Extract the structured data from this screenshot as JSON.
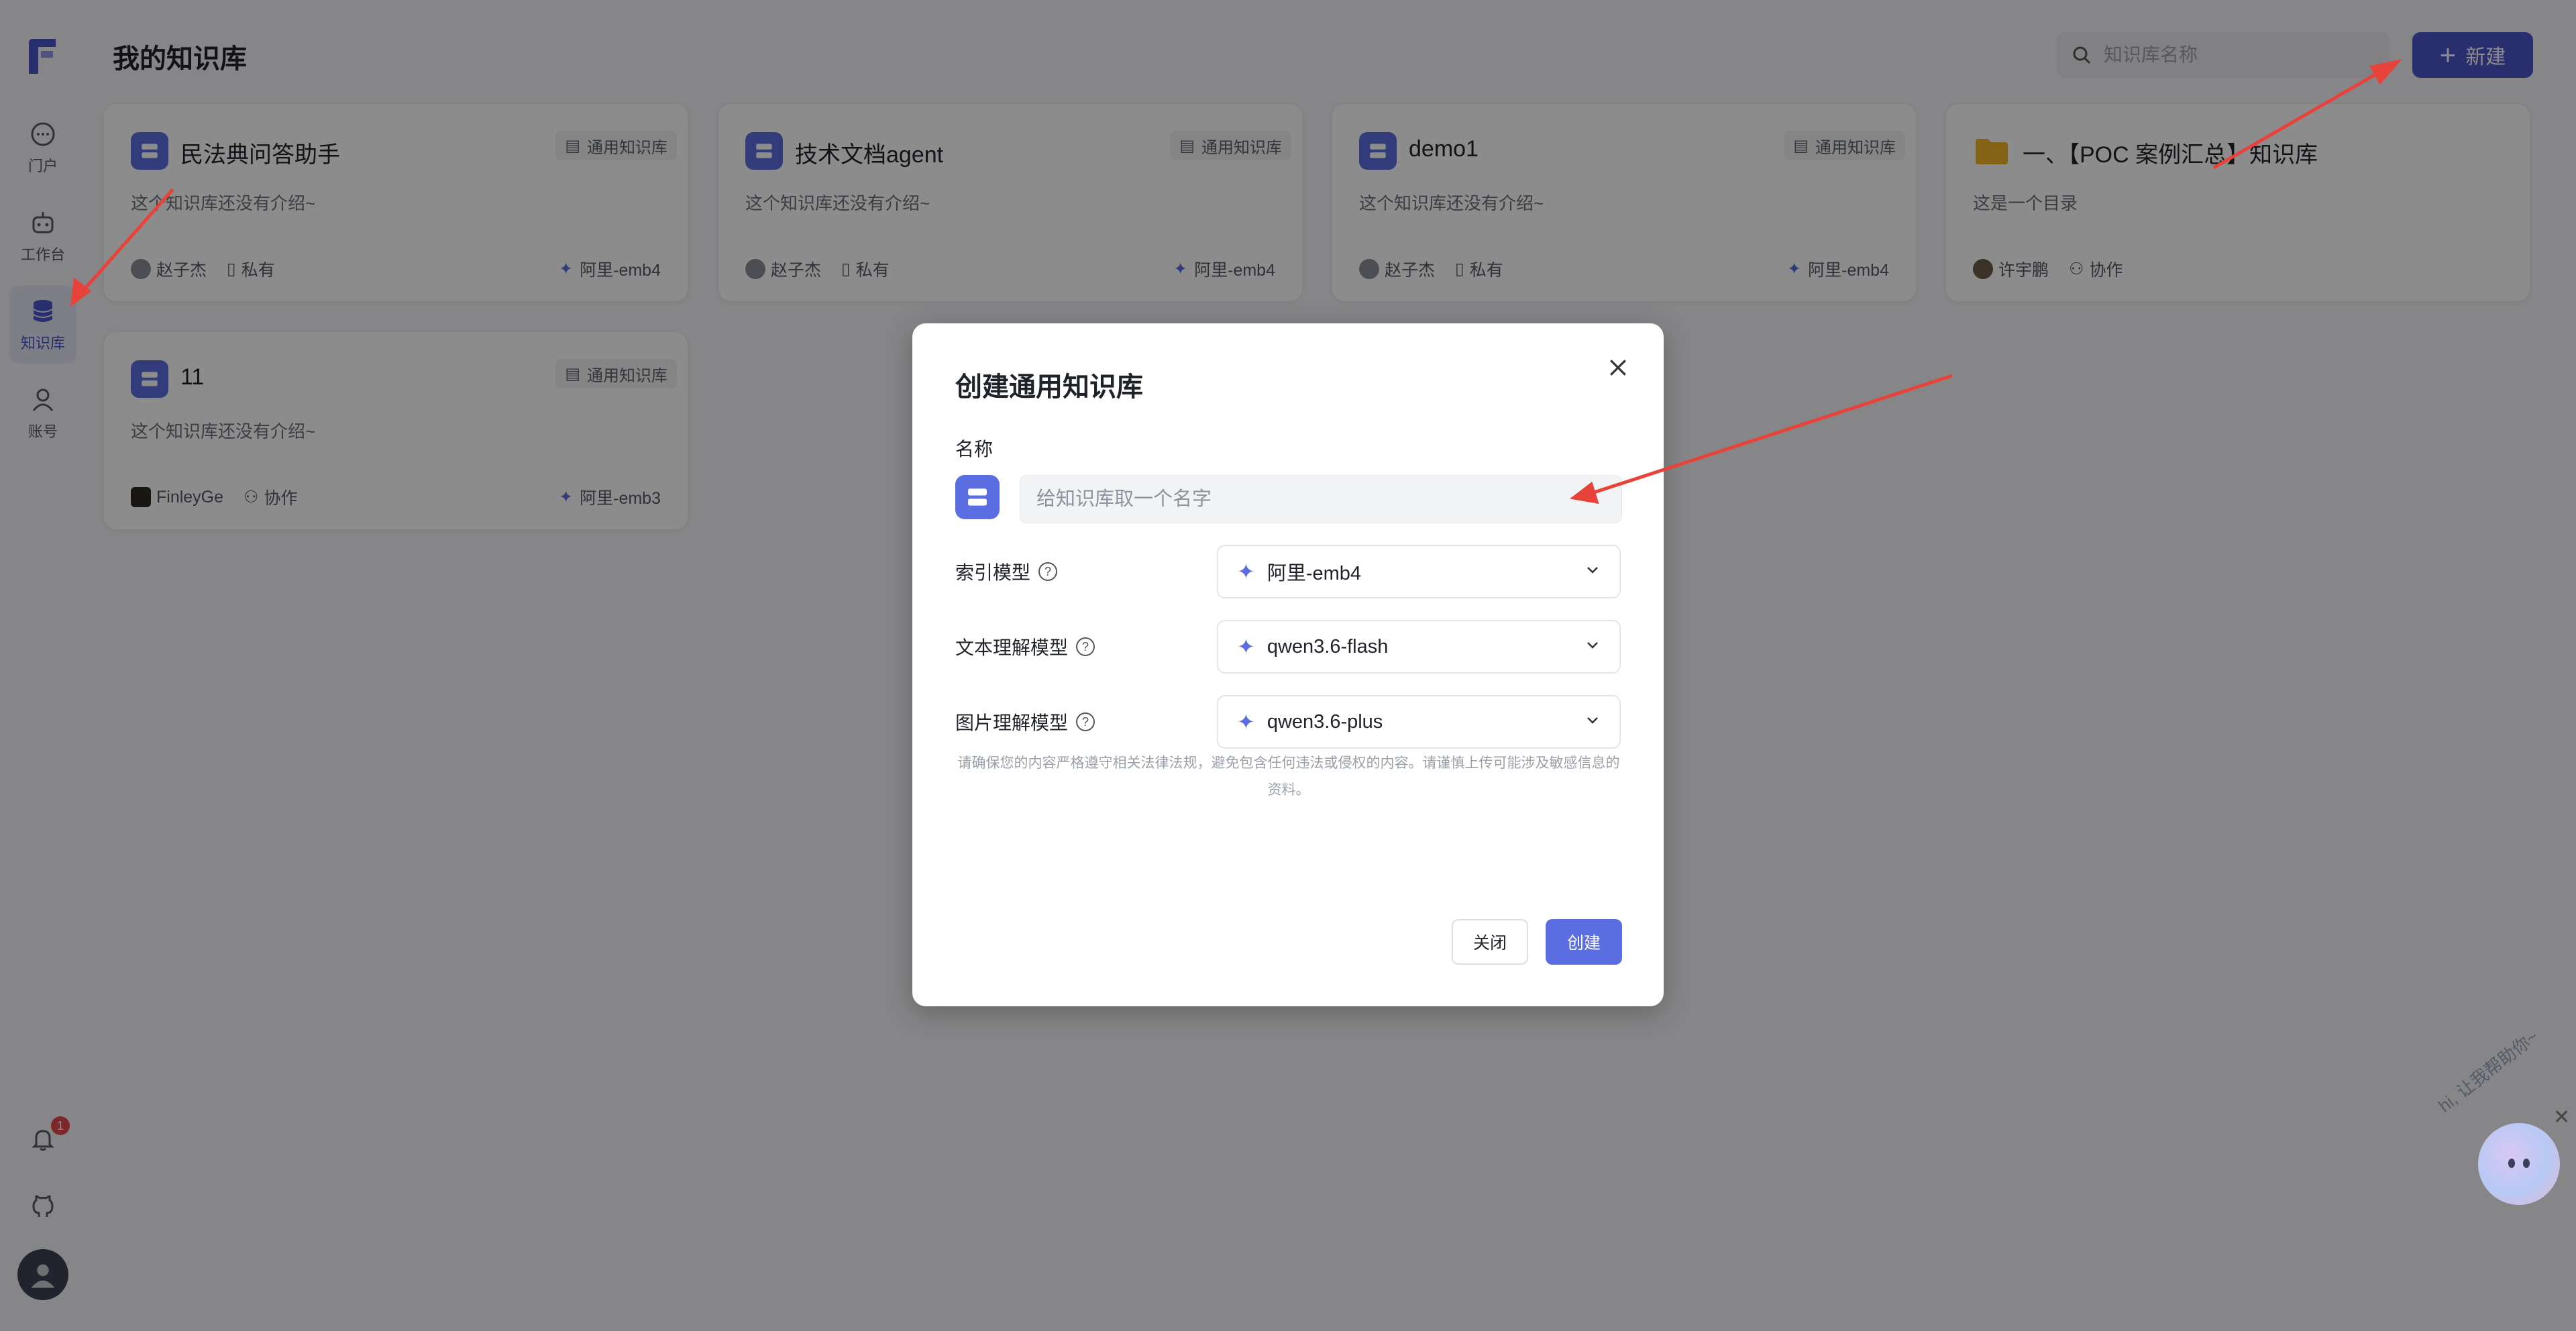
{
  "sidebar": {
    "items": [
      {
        "label": "门户",
        "icon": "chat-icon"
      },
      {
        "label": "工作台",
        "icon": "robot-icon"
      },
      {
        "label": "知识库",
        "icon": "database-icon",
        "active": true
      },
      {
        "label": "账号",
        "icon": "user-icon"
      }
    ],
    "notifications": {
      "count": "1"
    }
  },
  "header": {
    "title": "我的知识库",
    "search_placeholder": "知识库名称",
    "new_label": "新建"
  },
  "cards": [
    {
      "title": "民法典问答助手",
      "type": "通用知识库",
      "desc": "这个知识库还没有介绍~",
      "owner": "赵子杰",
      "visibility": "私有",
      "model": "阿里-emb4"
    },
    {
      "title": "技术文档agent",
      "type": "通用知识库",
      "desc": "这个知识库还没有介绍~",
      "owner": "赵子杰",
      "visibility": "私有",
      "model": "阿里-emb4"
    },
    {
      "title": "demo1",
      "type": "通用知识库",
      "desc": "这个知识库还没有介绍~",
      "owner": "赵子杰",
      "visibility": "私有",
      "model": "阿里-emb4"
    },
    {
      "title": "一、【POC 案例汇总】知识库",
      "desc": "这是一个目录",
      "owner": "许宇鹏",
      "visibility": "协作"
    },
    {
      "title": "11",
      "type": "通用知识库",
      "desc": "这个知识库还没有介绍~",
      "owner": "FinleyGe",
      "visibility": "协作",
      "model": "阿里-emb3"
    }
  ],
  "modal": {
    "title": "创建通用知识库",
    "name_label": "名称",
    "name_placeholder": "给知识库取一个名字",
    "index_model_label": "索引模型",
    "index_model_value": "阿里-emb4",
    "text_model_label": "文本理解模型",
    "text_model_value": "qwen3.6-flash",
    "image_model_label": "图片理解模型",
    "image_model_value": "qwen3.6-plus",
    "notice": "请确保您的内容严格遵守相关法律法规，避免包含任何违法或侵权的内容。请谨慎上传可能涉及敏感信息的资料。",
    "close_label": "关闭",
    "create_label": "创建"
  },
  "assistant": {
    "greeting": "hi, 让我帮助你~"
  },
  "colors": {
    "accent": "#5b6ee1",
    "primary": "#4b55c8",
    "annotation": "#e8433a"
  }
}
